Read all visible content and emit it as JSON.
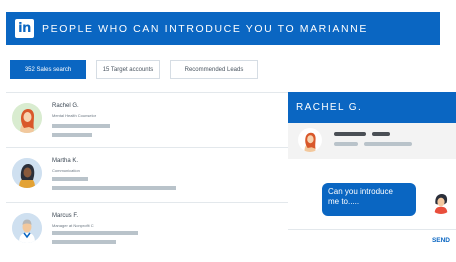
{
  "header": {
    "logo_text": "in",
    "title": "PEOPLE WHO CAN INTRODUCE YOU TO MARIANNE"
  },
  "filters": [
    {
      "label": "352 Sales search",
      "active": true
    },
    {
      "label": "15 Target accounts",
      "active": false
    },
    {
      "label": "Recommended Leads",
      "active": false
    }
  ],
  "people": [
    {
      "name": "Rachel G.",
      "role": "Mental Health Counselor",
      "icon": "woman-red-hair-avatar"
    },
    {
      "name": "Martha K.",
      "role": "Communication",
      "icon": "woman-dark-avatar"
    },
    {
      "name": "Marcus F.",
      "role": "Manager at Nonprofit C",
      "icon": "man-gray-hair-avatar"
    }
  ],
  "chat": {
    "title": "RACHEL G.",
    "message_line1": "Can you introduce",
    "message_line2": "me to.....",
    "send_label": "SEND"
  },
  "colors": {
    "brand": "#0a66c2",
    "text_bar": "#b9c3ca",
    "chip_border": "#d6dde4"
  }
}
